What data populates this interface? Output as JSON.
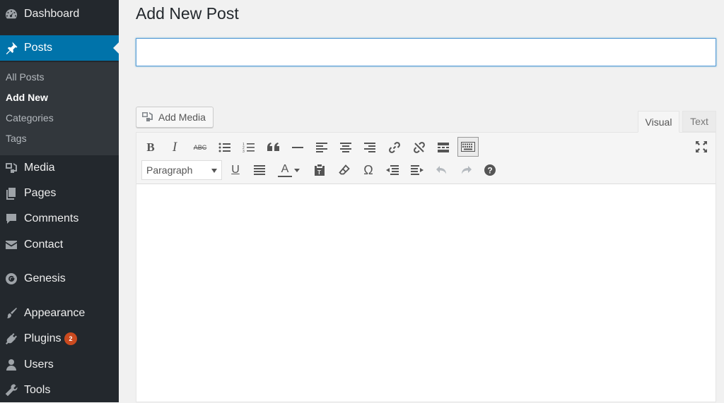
{
  "sidebar": {
    "items": [
      {
        "label": "Dashboard",
        "icon": "dashboard-icon"
      },
      {
        "label": "Posts",
        "icon": "pushpin-icon",
        "active": true
      },
      {
        "label": "Media",
        "icon": "media-icon"
      },
      {
        "label": "Pages",
        "icon": "pages-icon"
      },
      {
        "label": "Comments",
        "icon": "comments-icon"
      },
      {
        "label": "Contact",
        "icon": "envelope-icon"
      },
      {
        "label": "Genesis",
        "icon": "genesis-icon"
      },
      {
        "label": "Appearance",
        "icon": "brush-icon"
      },
      {
        "label": "Plugins",
        "icon": "plug-icon",
        "badge": "2"
      },
      {
        "label": "Users",
        "icon": "user-icon"
      },
      {
        "label": "Tools",
        "icon": "wrench-icon"
      }
    ],
    "submenu": [
      {
        "label": "All Posts"
      },
      {
        "label": "Add New",
        "current": true
      },
      {
        "label": "Categories"
      },
      {
        "label": "Tags"
      }
    ]
  },
  "main": {
    "page_title": "Add New Post",
    "title_input": {
      "value": "",
      "placeholder": ""
    },
    "add_media_label": "Add Media",
    "tabs": {
      "visual": "Visual",
      "text": "Text",
      "active": "Visual"
    },
    "toolbar": {
      "format_select": "Paragraph",
      "bold_label": "B",
      "italic_label": "I",
      "strike_label": "ABC",
      "underline_label": "U",
      "text_color_label": "A",
      "special_char_label": "Ω"
    }
  },
  "colors": {
    "sidebar_bg": "#23282d",
    "submenu_bg": "#32373c",
    "active_bg": "#0073aa",
    "badge_bg": "#ca4a1f",
    "page_bg": "#f1f1f1",
    "focus_border": "#5b9dd9"
  }
}
